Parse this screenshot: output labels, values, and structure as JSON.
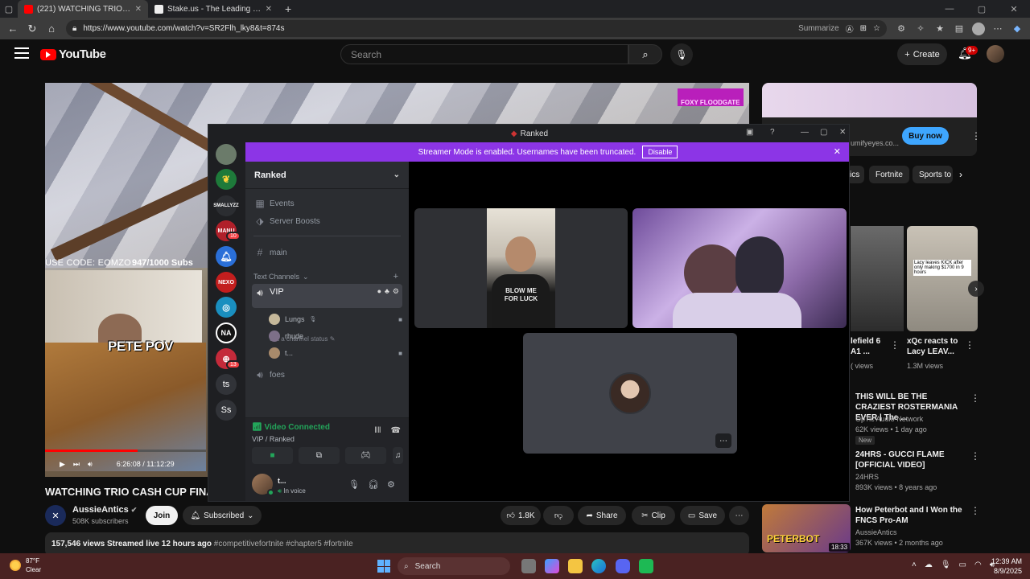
{
  "browser": {
    "tabs": [
      {
        "label": "(221) WATCHING TRIO CASH CUP",
        "active": true,
        "favicon_color": "#ff0000"
      },
      {
        "label": "Stake.us - The Leading Social Ca",
        "active": false,
        "favicon_color": "#1a2c38"
      }
    ],
    "url": "https://www.youtube.com/watch?v=SR2Flh_lky8&t=874s",
    "summarize_label": "Summarize"
  },
  "youtube": {
    "logo_text": "YouTube",
    "search_placeholder": "Search",
    "create_label": "Create",
    "notifications_badge": "9+",
    "video": {
      "overlay_use_code": "USE CODE: EOMZO",
      "overlay_subs": "947/1000 Subs",
      "overlay_pete": "PETE POV",
      "overlay_foxy": "FOXY FLOODGATE",
      "time_current": "6:26:08",
      "time_total": "11:12:29",
      "progress_fraction": 0.575
    },
    "title": "WATCHING TRIO CASH CUP FINA",
    "channel": {
      "name": "AussieAntics",
      "subscribers": "508K subscribers",
      "join_label": "Join",
      "subscribed_label": "Subscribed"
    },
    "actions": {
      "likes": "1.8K",
      "share_label": "Share",
      "clip_label": "Clip",
      "save_label": "Save"
    },
    "description": {
      "views": "157,546 views",
      "streamed": "Streamed live 12 hours ago",
      "tags": "#competitivefortnite #chapter5 #fortnite"
    },
    "ad": {
      "site": "umifyeyes.co...",
      "buy_label": "Buy now"
    },
    "chips": [
      "ics",
      "Fortnite",
      "Sports to"
    ],
    "related": [
      {
        "title": "lefield 6 A1 ...",
        "meta": "( views"
      },
      {
        "title": "xQc reacts to Lacy LEAV...",
        "meta": "1.3M views",
        "thumb_text": "Lacy leaves KICK after only making $1700 in 9 hours"
      },
      {
        "title": "THIS WILL BE THE CRAZIEST ROSTERMANIA EVER | The ...",
        "channel": "OpTic Audio Network",
        "meta": "62K views • 1 day ago",
        "badge": "New"
      },
      {
        "title": "24HRS - GUCCI FLAME [OFFICIAL VIDEO]",
        "channel": "24HRS",
        "meta": "893K views • 8 years ago"
      },
      {
        "title": "How Peterbot and I Won the FNCS Pro-AM",
        "channel": "AussieAntics",
        "meta": "367K views • 2 months ago",
        "duration": "18:33",
        "thumb_text": "PETERBOT"
      }
    ]
  },
  "discord": {
    "window_title": "Ranked",
    "banner_text": "Streamer Mode is enabled. Usernames have been truncated.",
    "banner_button": "Disable",
    "guild_name": "Ranked",
    "servers": [
      {
        "label": "",
        "color": "#6b7b6a"
      },
      {
        "label": "",
        "color": "#1e7a3a"
      },
      {
        "label": "SMALLYZZ",
        "color": "#2b2d31"
      },
      {
        "label": "MANU",
        "color": "#b0202a",
        "badge": "10"
      },
      {
        "label": "",
        "color": "#2a6fd8"
      },
      {
        "label": "NEXO",
        "color": "#c21e1e"
      },
      {
        "label": "",
        "color": "#1a8fbf"
      },
      {
        "label": "NA",
        "color": "#141414"
      },
      {
        "label": "",
        "color": "#c42a3a",
        "badge": "13"
      },
      {
        "label": "ts",
        "color": "#313338"
      },
      {
        "label": "Ss",
        "color": "#313338"
      }
    ],
    "channels": {
      "events": "Events",
      "boosts": "Server Boosts",
      "main": "main",
      "category": "Text Channels",
      "vip": "VIP",
      "vip_status": "Set a channel status",
      "foes": "foes"
    },
    "members": [
      {
        "name": "Lungs",
        "color": "#c5b89a",
        "camera": true
      },
      {
        "name": "rhude",
        "color": "#7d6f88",
        "camera": false
      },
      {
        "name": "t...",
        "color": "#a88a6b",
        "camera": true
      }
    ],
    "voice": {
      "status": "Video Connected",
      "location": "VIP / Ranked"
    },
    "user": {
      "name": "t...",
      "status": "In voice"
    },
    "tiles": {
      "shirt_text": "BLOW ME FOR LUCK"
    }
  },
  "taskbar": {
    "temperature": "87°F",
    "weather": "Clear",
    "search_label": "Search",
    "time": "12:39 AM",
    "date": "8/9/2025"
  }
}
